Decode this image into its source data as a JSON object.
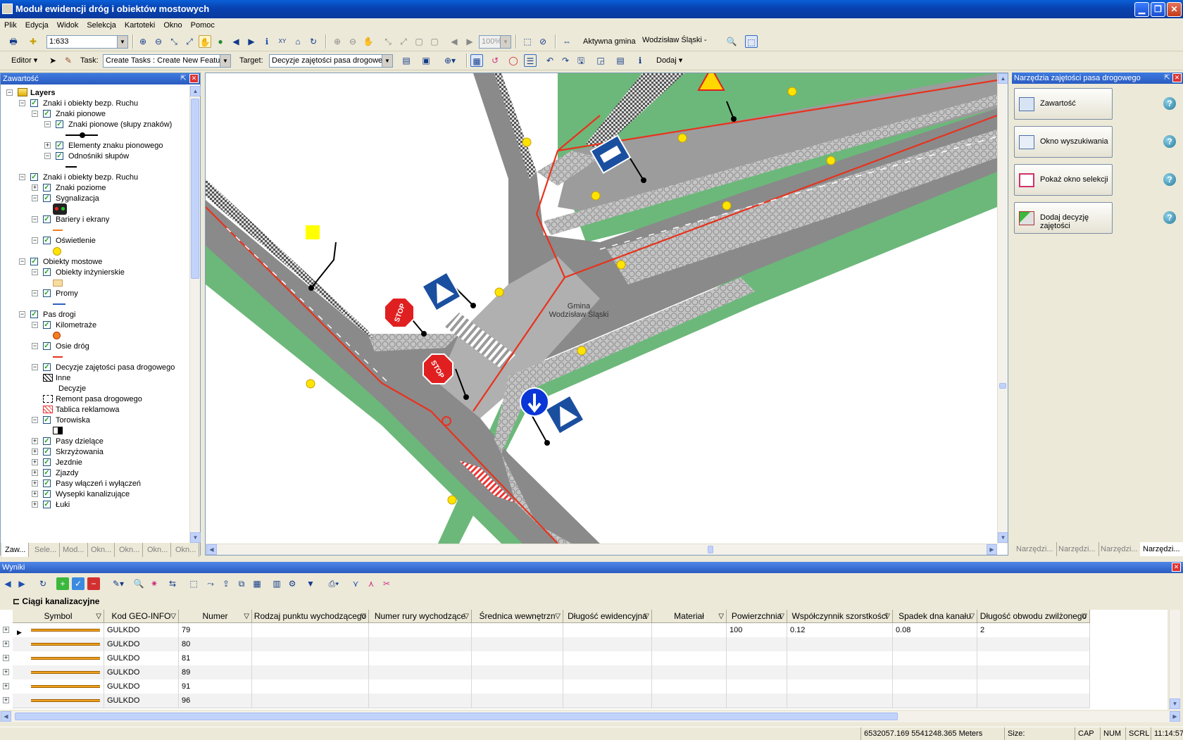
{
  "window": {
    "title": "Moduł ewidencji dróg i obiektów mostowych",
    "icon": "map-app-icon"
  },
  "menu": [
    "Plik",
    "Edycja",
    "Widok",
    "Selekcja",
    "Kartoteki",
    "Okno",
    "Pomoc"
  ],
  "toolbar1": {
    "scale": "1:633",
    "zoom_percent": "100%",
    "aktywna_gmina_label": "Aktywna gmina",
    "aktywna_gmina_value": "Wodzisław Śląski -"
  },
  "toolbar2": {
    "editor": "Editor",
    "task_label": "Task:",
    "task_value": "Create Tasks : Create New Featu",
    "target_label": "Target:",
    "target_value": "Decyzje zajętości pasa drogoweg",
    "dodaj": "Dodaj"
  },
  "toc": {
    "title": "Zawartość",
    "items": [
      {
        "label": "Layers",
        "level": 0,
        "exp": "-",
        "check": false,
        "bold": true
      },
      {
        "label": "Znaki i obiekty bezp. Ruchu",
        "level": 1,
        "exp": "-",
        "check": true
      },
      {
        "label": "Znaki pionowe",
        "level": 2,
        "exp": "-",
        "check": true
      },
      {
        "label": "Znaki pionowe (słupy znaków)",
        "level": 3,
        "exp": "-",
        "check": true
      },
      {
        "label": "",
        "level": 4,
        "symbol": "point-line"
      },
      {
        "label": "Elementy znaku pionowego",
        "level": 3,
        "exp": "+",
        "check": true
      },
      {
        "label": "Odnośniki słupów",
        "level": 3,
        "exp": "-",
        "check": true
      },
      {
        "label": "",
        "level": 4,
        "symbol": "black-line"
      },
      {
        "label": "Znaki i obiekty bezp. Ruchu",
        "level": 1,
        "exp": "-",
        "check": true
      },
      {
        "label": "Znaki poziome",
        "level": 2,
        "exp": "+",
        "check": true
      },
      {
        "label": "Sygnalizacja",
        "level": 2,
        "exp": "-",
        "check": true
      },
      {
        "label": "",
        "level": 3,
        "symbol": "traffic-light"
      },
      {
        "label": "Bariery i ekrany",
        "level": 2,
        "exp": "-",
        "check": true
      },
      {
        "label": "",
        "level": 3,
        "symbol": "orange-line"
      },
      {
        "label": "Oświetlenie",
        "level": 2,
        "exp": "-",
        "check": true
      },
      {
        "label": "",
        "level": 3,
        "symbol": "yellow-dot"
      },
      {
        "label": "Obiekty mostowe",
        "level": 1,
        "exp": "-",
        "check": true
      },
      {
        "label": "Obiekty inżynierskie",
        "level": 2,
        "exp": "-",
        "check": true
      },
      {
        "label": "",
        "level": 3,
        "symbol": "beige-box"
      },
      {
        "label": "Promy",
        "level": 2,
        "exp": "-",
        "check": true
      },
      {
        "label": "",
        "level": 3,
        "symbol": "blue-line"
      },
      {
        "label": "Pas drogi",
        "level": 1,
        "exp": "-",
        "check": true
      },
      {
        "label": "Kilometraże",
        "level": 2,
        "exp": "-",
        "check": true
      },
      {
        "label": "",
        "level": 3,
        "symbol": "orange-circle"
      },
      {
        "label": "Osie dróg",
        "level": 2,
        "exp": "-",
        "check": true
      },
      {
        "label": "",
        "level": 3,
        "symbol": "red-line"
      },
      {
        "label": "Decyzje zajętości pasa drogowego",
        "level": 2,
        "exp": "-",
        "check": true
      },
      {
        "label": "Inne",
        "level": 3,
        "symbol": "hatch-box"
      },
      {
        "label": "Decyzje",
        "level": 4,
        "symbol": "none"
      },
      {
        "label": "Remont pasa drogowego",
        "level": 3,
        "symbol": "dash-box"
      },
      {
        "label": "Tablica reklamowa",
        "level": 3,
        "symbol": "red-hatch-box"
      },
      {
        "label": "Torowiska",
        "level": 2,
        "exp": "-",
        "check": true
      },
      {
        "label": "",
        "level": 3,
        "symbol": "bw-box"
      },
      {
        "label": "Pasy dzielące",
        "level": 2,
        "exp": "+",
        "check": true
      },
      {
        "label": "Skrzyżowania",
        "level": 2,
        "exp": "+",
        "check": true
      },
      {
        "label": "Jezdnie",
        "level": 2,
        "exp": "+",
        "check": true
      },
      {
        "label": "Zjazdy",
        "level": 2,
        "exp": "+",
        "check": true
      },
      {
        "label": "Pasy włączeń i wyłączeń",
        "level": 2,
        "exp": "+",
        "check": true
      },
      {
        "label": "Wysepki kanalizujące",
        "level": 2,
        "exp": "+",
        "check": true
      },
      {
        "label": "Łuki",
        "level": 2,
        "exp": "+",
        "check": true
      }
    ],
    "tabs": [
      "Zaw...",
      "Sele...",
      "Mod...",
      "Okn...",
      "Okn...",
      "Okn...",
      "Okn..."
    ]
  },
  "map": {
    "gmina_label_1": "Gmina",
    "gmina_label_2": "Wodzisław Śląski",
    "stop": "STOP"
  },
  "right_panel": {
    "title": "Narzędzia zajętości pasa drogowego",
    "buttons": [
      "Zawartość",
      "Okno wyszukiwania",
      "Pokaż okno selekcji",
      "Dodaj decyzję zajętości"
    ],
    "help": "?",
    "tabs": [
      "Narzędzi...",
      "Narzędzi...",
      "Narzędzi...",
      "Narzędzi..."
    ]
  },
  "results": {
    "title": "Wyniki",
    "table_title": "Ciągi kanalizacyjne",
    "columns": [
      "Symbol",
      "Kod GEO-INFO",
      "Numer",
      "Rodzaj punktu wychodzącego",
      "Numer rury wychodzące",
      "Średnica wewnętrzn",
      "Długość ewidencyjna",
      "Materiał",
      "Powierzchnia",
      "Współczynnik szorstkości",
      "Spadek dna kanału",
      "Długość obwodu zwilżonego"
    ],
    "rows": [
      [
        "",
        "GULKDO",
        "79",
        "",
        "",
        "",
        "",
        "",
        "100",
        "0.12",
        "0.08",
        "2"
      ],
      [
        "",
        "GULKDO",
        "80",
        "",
        "",
        "",
        "",
        "",
        "",
        "",
        "",
        ""
      ],
      [
        "",
        "GULKDO",
        "81",
        "",
        "",
        "",
        "",
        "",
        "",
        "",
        "",
        ""
      ],
      [
        "",
        "GULKDO",
        "89",
        "",
        "",
        "",
        "",
        "",
        "",
        "",
        "",
        ""
      ],
      [
        "",
        "GULKDO",
        "91",
        "",
        "",
        "",
        "",
        "",
        "",
        "",
        "",
        ""
      ],
      [
        "",
        "GULKDO",
        "96",
        "",
        "",
        "",
        "",
        "",
        "",
        "",
        "",
        ""
      ]
    ]
  },
  "status": {
    "coords": "6532057.169 5541248.365 Meters",
    "size": "Size:",
    "cap": "CAP",
    "num": "NUM",
    "scrl": "SCRL",
    "time": "11:14:57"
  },
  "colors": {
    "road": "#8a8a8a",
    "verge": "#6cb87a",
    "axis": "#e8321e",
    "cobble": "#b9b9b9",
    "titlebar": "#0a5fd8"
  }
}
